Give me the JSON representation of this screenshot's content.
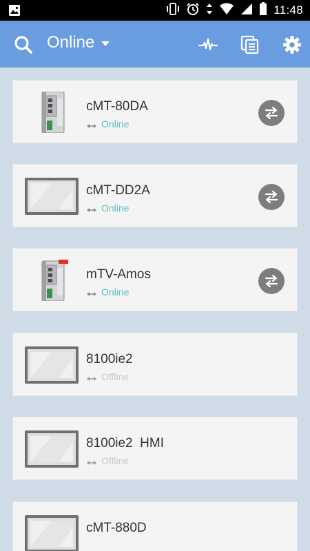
{
  "status_bar": {
    "time": "11:48"
  },
  "app_bar": {
    "filter_label": "Online",
    "icons": [
      "search-icon",
      "pulse-icon",
      "pages-icon",
      "gear-icon"
    ],
    "color": "#6a9ce0"
  },
  "devices": [
    {
      "name": "cMT-80DA",
      "status": "Online",
      "type": "box",
      "badge": false,
      "connectable": true
    },
    {
      "name": "cMT-DD2A",
      "status": "Online",
      "type": "panel",
      "badge": false,
      "connectable": true
    },
    {
      "name": "mTV-Amos",
      "status": "Online",
      "type": "box",
      "badge": true,
      "connectable": true
    },
    {
      "name": "8100ie2",
      "status": "Offline",
      "type": "panel",
      "badge": false,
      "connectable": false
    },
    {
      "name": "8100ie2  HMI",
      "status": "Offline",
      "type": "panel",
      "badge": false,
      "connectable": false
    },
    {
      "name": "cMT-880D",
      "status": "",
      "type": "panel",
      "badge": false,
      "connectable": false
    }
  ],
  "colors": {
    "online": "#5cbcc4",
    "offline": "#c8c8c8",
    "background": "#cfdbe7"
  }
}
